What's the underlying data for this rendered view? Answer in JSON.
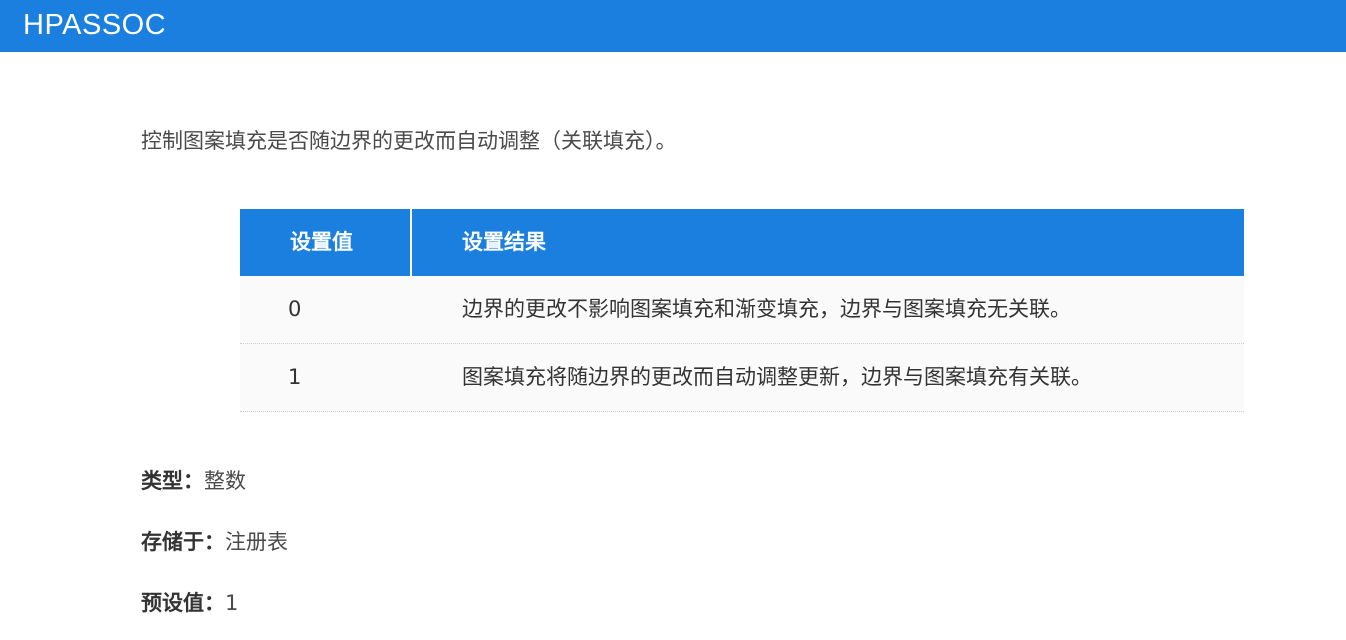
{
  "header": {
    "title": "HPASSOC"
  },
  "description": "控制图案填充是否随边界的更改而自动调整（关联填充）。",
  "table": {
    "columns": [
      "设置值",
      "设置结果"
    ],
    "rows": [
      {
        "value": "0",
        "result": "边界的更改不影响图案填充和渐变填充，边界与图案填充无关联。"
      },
      {
        "value": "1",
        "result": "图案填充将随边界的更改而自动调整更新，边界与图案填充有关联。"
      }
    ]
  },
  "properties": {
    "type": {
      "label": "类型：",
      "value": "整数"
    },
    "stored_in": {
      "label": "存储于：",
      "value": "注册表"
    },
    "default": {
      "label": "预设值：",
      "value": "1"
    }
  }
}
